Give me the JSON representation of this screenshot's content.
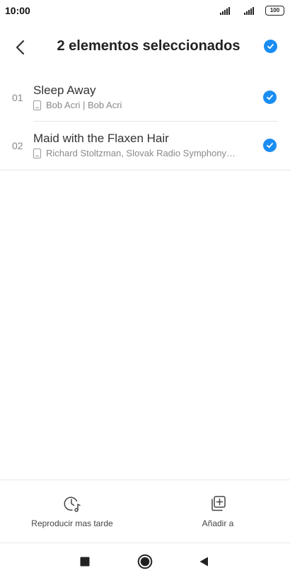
{
  "status_bar": {
    "time": "10:00",
    "battery": "100"
  },
  "header": {
    "title": "2 elementos seleccionados"
  },
  "tracks": [
    {
      "index": "01",
      "title": "Sleep Away",
      "subtitle": "Bob Acri | Bob Acri",
      "selected": true
    },
    {
      "index": "02",
      "title": "Maid with the Flaxen Hair",
      "subtitle": "Richard Stoltzman, Slovak Radio Symphony…",
      "selected": true
    }
  ],
  "actions": {
    "play_later_label": "Reproducir mas tarde",
    "add_to_label": "Añadir a"
  },
  "colors": {
    "accent": "#1a8df2",
    "text_primary": "#222222",
    "text_secondary": "#8a8a8a"
  },
  "icons": {
    "back": "chevron-left-icon",
    "select_all": "check-circle-icon",
    "device": "phone-storage-icon",
    "play_later": "clock-music-icon",
    "add_to": "add-to-playlist-icon",
    "nav_recents": "square-icon",
    "nav_home": "circle-icon",
    "nav_back": "triangle-left-icon"
  }
}
